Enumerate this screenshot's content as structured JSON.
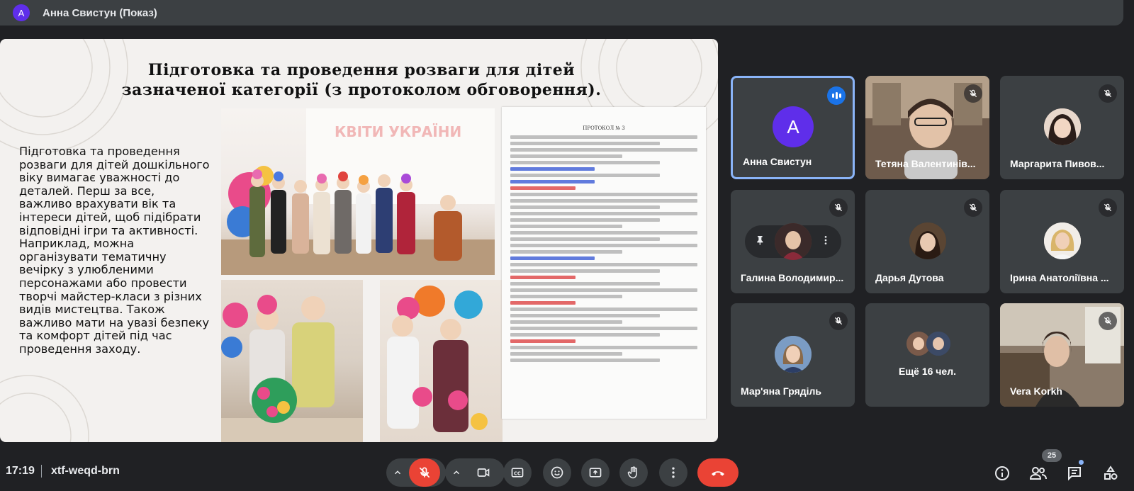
{
  "topbar": {
    "avatar_letter": "A",
    "title": "Анна Свистун (Показ)"
  },
  "slide": {
    "title_line1": "Підготовка та проведення розваги для дітей",
    "title_line2": "зазначеної категорії (з протоколом обговорення).",
    "body": "Підготовка та проведення розваги для дітей дошкільного віку вимагає уважності до деталей. Перш за все, важливо врахувати вік та інтереси дітей, щоб підібрати відповідні ігри та активності. Наприклад, можна організувати тематичну вечірку з улюбленими персонажами або провести творчі майстер-класи з різних видів мистецтва. Також важливо мати на увазі безпеку та комфорт дітей під час проведення заходу.",
    "photo_banner": "КВІТИ УКРАЇНИ",
    "document_heading": "ПРОТОКОЛ № 3"
  },
  "participants": [
    {
      "name": "Анна Свистун",
      "avatar_letter": "A",
      "state": "speaking",
      "avatar_color": "#5f2eea"
    },
    {
      "name": "Тетяна Валентинів...",
      "state": "muted"
    },
    {
      "name": "Маргарита Пивов...",
      "state": "muted"
    },
    {
      "name": "Галина Володимир...",
      "state": "pinned"
    },
    {
      "name": "Дарья Дутова",
      "state": "muted"
    },
    {
      "name": "Ірина Анатоліївна ...",
      "state": "muted"
    },
    {
      "name": "Мар'яна Гряділь",
      "state": "muted"
    },
    {
      "name": "Ещё 16 чел.",
      "state": "more"
    },
    {
      "name": "Vera Korkh",
      "state": "muted"
    }
  ],
  "bottombar": {
    "time": "17:19",
    "meeting_code": "xtf-weqd-brn",
    "participants_count": "25",
    "icons": [
      "chevron-up-icon",
      "mic-off-icon",
      "chevron-up-icon",
      "camera-icon",
      "captions-icon",
      "emoji-icon",
      "present-icon",
      "raise-hand-icon",
      "more-vert-icon",
      "end-call-icon",
      "info-icon",
      "people-icon",
      "chat-icon",
      "activities-icon"
    ]
  },
  "colors": {
    "background": "#202124",
    "tile": "#3c4043",
    "accent": "#8ab4f8",
    "end_call": "#ea4335",
    "avatar": "#5f2eea"
  }
}
